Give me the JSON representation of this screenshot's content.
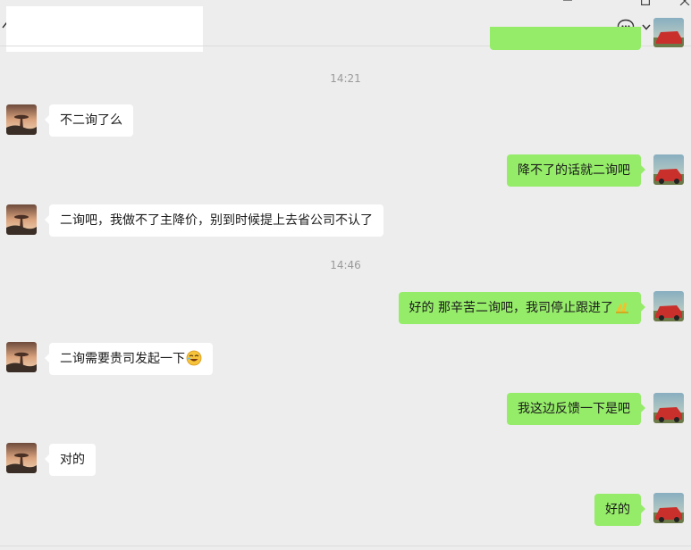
{
  "header": {
    "chat_title": "",
    "icons": [
      "back-chevron-icon",
      "pin-icon",
      "maximize-icon",
      "close-icon",
      "chat-bubble-icon",
      "chevron-down-icon",
      "more-icon"
    ]
  },
  "colors": {
    "background": "#ededed",
    "incoming_bubble": "#ffffff",
    "outgoing_bubble": "#95ec69",
    "timestamp_text": "#9a9a9a"
  },
  "messages": {
    "ts1": "14:21",
    "m1": "不二询了么",
    "m2": "降不了的话就二询吧",
    "m3": "二询吧，我做不了主降价，别到时候提上去省公司不认了",
    "ts2": "14:46",
    "m4": "好的 那辛苦二询吧，我司停止跟进了",
    "m4_emoji": "hands-icon",
    "m5": "二询需要贵司发起一下",
    "m5_emoji": "laughing-emoji-icon",
    "m6": "我这边反馈一下是吧",
    "m7": "对的",
    "m8": "好的"
  }
}
